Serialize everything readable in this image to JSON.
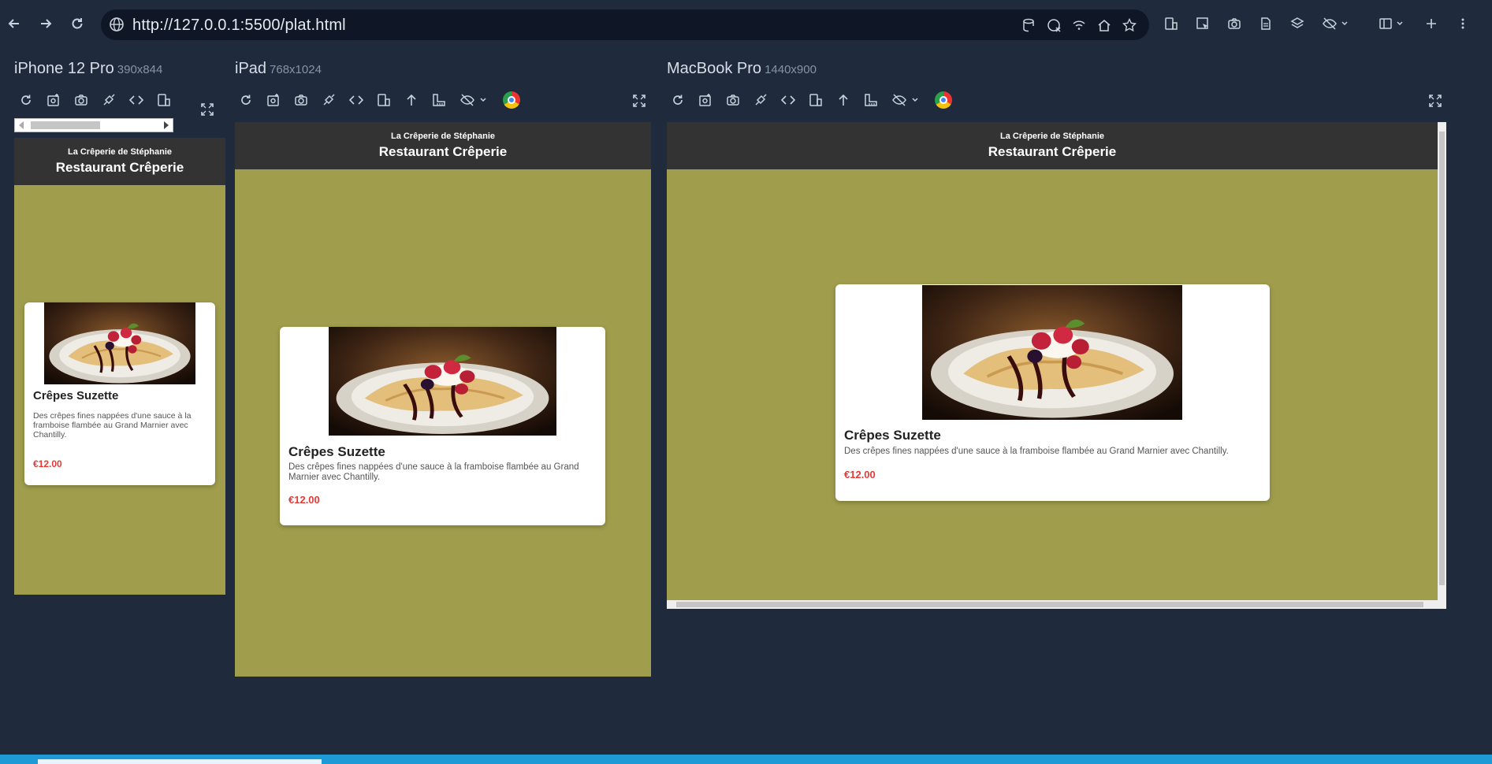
{
  "browser": {
    "url": "http://127.0.0.1:5500/plat.html"
  },
  "devices": [
    {
      "name": "iPhone 12 Pro",
      "resolution": "390x844"
    },
    {
      "name": "iPad",
      "resolution": "768x1024"
    },
    {
      "name": "MacBook Pro",
      "resolution": "1440x900"
    }
  ],
  "site": {
    "subtitle": "La Crêperie de Stéphanie",
    "title": "Restaurant Crêperie",
    "background_color": "#a09e4c",
    "header_color": "#333333",
    "dish": {
      "name": "Crêpes Suzette",
      "description": "Des crêpes fines nappées d'une sauce à la framboise flambée au Grand Marnier avec Chantilly.",
      "price": "€12.00",
      "price_color": "#e53935"
    }
  },
  "icons": {
    "reload": "reload-icon",
    "screenshot": "camera-icon",
    "expand": "expand-icon"
  }
}
